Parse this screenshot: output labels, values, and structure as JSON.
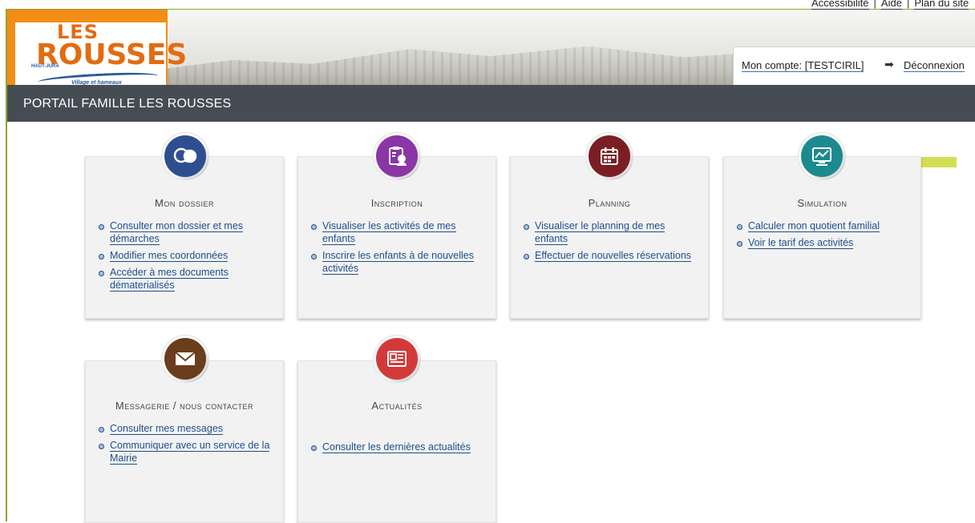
{
  "header": {
    "top_links": [
      "Accessibilité",
      "Aide",
      "Plan du site"
    ],
    "account_label": "Mon compte: [TESTCIRIL]",
    "logout_label": "Déconnexion",
    "logo": {
      "line1": "LES",
      "line2": "ROUSSES",
      "tag": "HAUT-JURA",
      "sub": "Village et hameaux"
    }
  },
  "title_bar": {
    "title": "PORTAIL FAMILLE LES ROUSSES"
  },
  "tiles": [
    {
      "title": "Mon dossier",
      "icon": "profile-icon",
      "color": "#2e4f8f",
      "links": [
        "Consulter mon dossier et mes démarches",
        "Modifier mes coordonnées",
        "Accéder à mes documents dématerialisés"
      ]
    },
    {
      "title": "Inscription",
      "icon": "clipboard-user-icon",
      "color": "#8a36a6",
      "links": [
        "Visualiser les activités de mes enfants",
        "Inscrire les enfants à de nouvelles activités"
      ]
    },
    {
      "title": "Planning",
      "icon": "calendar-icon",
      "color": "#7b1e24",
      "links": [
        "Visualiser le planning de mes enfants",
        "Effectuer de nouvelles réservations"
      ]
    },
    {
      "title": "Simulation",
      "icon": "monitor-icon",
      "color": "#1c8a8f",
      "links": [
        "Calculer mon quotient familial",
        "Voir le tarif des activités"
      ]
    },
    {
      "title": "Messagerie / nous contacter",
      "icon": "envelope-icon",
      "color": "#6a3d1c",
      "links": [
        "Consulter mes messages",
        "Communiquer avec un service de la Mairie"
      ]
    },
    {
      "title": "Actualités",
      "icon": "newspaper-icon",
      "color": "#d23a3a",
      "links": [
        "Consulter les dernières actualités"
      ]
    }
  ]
}
